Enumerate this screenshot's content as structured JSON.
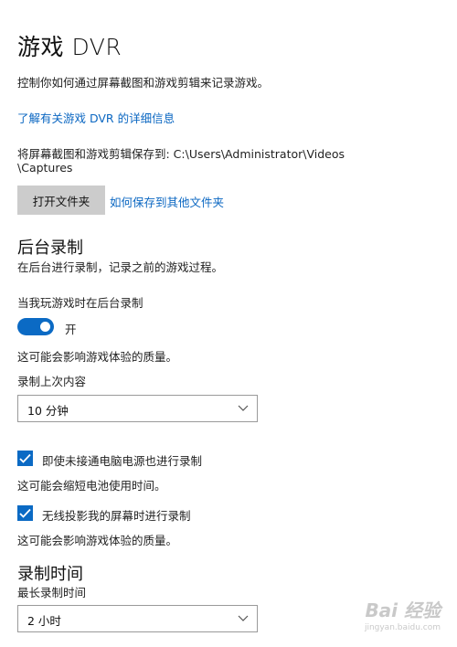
{
  "page": {
    "title": "游戏 DVR",
    "description": "控制你如何通过屏幕截图和游戏剪辑来记录游戏。",
    "learn_more_link": "了解有关游戏 DVR 的详细信息",
    "save_path_line1": "将屏幕截图和游戏剪辑保存到: C:\\Users\\Administrator\\Videos",
    "save_path_line2": "\\Captures",
    "open_folder_button": "打开文件夹",
    "save_other_link": "如何保存到其他文件夹"
  },
  "background_recording": {
    "heading": "后台录制",
    "description": "在后台进行录制，记录之前的游戏过程。",
    "toggle_label": "当我玩游戏时在后台录制",
    "toggle_state_text": "开",
    "toggle_on": true,
    "quality_note": "这可能会影响游戏体验的质量。",
    "record_last_label": "录制上次内容",
    "record_last_value": "10 分钟",
    "battery_check_label": "即使未接通电脑电源也进行录制",
    "battery_check_checked": true,
    "battery_note": "这可能会缩短电池使用时间。",
    "wireless_check_label": "无线投影我的屏幕时进行录制",
    "wireless_check_checked": true,
    "wireless_note": "这可能会影响游戏体验的质量。"
  },
  "recording_time": {
    "heading": "录制时间",
    "max_label": "最长录制时间",
    "max_value": "2 小时"
  },
  "watermark": {
    "brand": "Bai 经验",
    "url": "jingyan.baidu.com"
  },
  "colors": {
    "accent": "#0b6ac4",
    "link": "#0b67c2",
    "button_bg": "#cccccc"
  }
}
